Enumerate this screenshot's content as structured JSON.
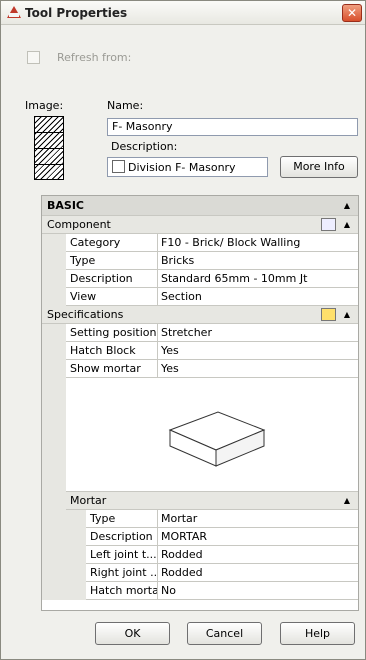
{
  "window": {
    "title": "Tool Properties",
    "close": "✕"
  },
  "refresh": {
    "label": "Refresh from:"
  },
  "image": {
    "label": "Image:"
  },
  "name": {
    "label": "Name:",
    "value": "F- Masonry"
  },
  "description": {
    "label": "Description:",
    "value": "Division F- Masonry",
    "more_info": "More Info"
  },
  "grid": {
    "basic": "BASIC",
    "component": {
      "label": "Component",
      "rows": [
        {
          "key": "Category",
          "value": "F10 - Brick/ Block Walling"
        },
        {
          "key": "Type",
          "value": "Bricks"
        },
        {
          "key": "Description",
          "value": "Standard 65mm - 10mm Jt"
        },
        {
          "key": "View",
          "value": "Section"
        }
      ]
    },
    "specifications": {
      "label": "Specifications",
      "rows": [
        {
          "key": "Setting position",
          "value": "Stretcher"
        },
        {
          "key": "Hatch Block",
          "value": "Yes"
        },
        {
          "key": "Show mortar",
          "value": "Yes"
        }
      ]
    },
    "mortar": {
      "label": "Mortar",
      "rows": [
        {
          "key": "Type",
          "value": "Mortar"
        },
        {
          "key": "Description",
          "value": "MORTAR"
        },
        {
          "key": "Left joint t...",
          "value": "Rodded"
        },
        {
          "key": "Right joint ...",
          "value": "Rodded"
        },
        {
          "key": "Hatch mortar",
          "value": "No"
        }
      ]
    },
    "collapse_icon": "▲"
  },
  "buttons": {
    "ok": "OK",
    "cancel": "Cancel",
    "help": "Help"
  },
  "colors": {
    "close": "#d8502c",
    "grid_border": "#a9a9a4"
  }
}
